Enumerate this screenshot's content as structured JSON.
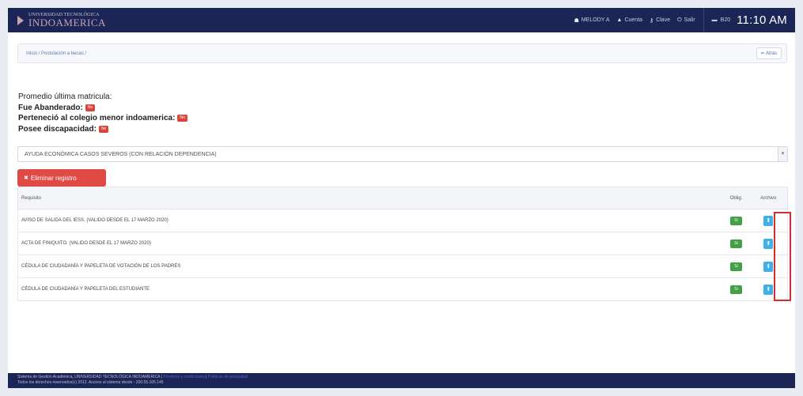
{
  "header": {
    "logo_small": "UNIVERSIDAD TECNOLÓGICA",
    "logo_big": "INDOAMERICA",
    "user": "MELODY A",
    "cuenta": "Cuenta",
    "clave": "Clave",
    "salir": "Salir",
    "room": "B20",
    "time": "11:10 AM",
    "icons": {
      "user": "user-icon",
      "cuenta": "person-icon",
      "clave": "key-icon",
      "salir": "power-icon",
      "room": "card-icon"
    }
  },
  "breadcrumb": {
    "text": "Inicio / Postulación a becas /",
    "back_label": "⇐ Atrás"
  },
  "info": {
    "promedio": "Promedio última matricula:",
    "abanderado_label": "Fue Abanderado:",
    "abanderado_value": "No",
    "colegio_label": "Perteneció al colegio menor indoamerica:",
    "colegio_value": "No",
    "discapacidad_label": "Posee discapacidad:",
    "discapacidad_value": "No"
  },
  "select": {
    "value": "AYUDA ECONÓMICA CASOS SEVEROS (CON RELACIÓN DEPENDENCIA)"
  },
  "delete_button": {
    "label": "Eliminar registro"
  },
  "table": {
    "headers": {
      "requisito": "Requisito",
      "oblig": "Oblig.",
      "archivo": "Archivo"
    },
    "rows": [
      {
        "requisito": "AVISO DE SALIDA DEL IESS. (VALIDO DESDE EL 17 MARZO 2020)",
        "oblig": "Si"
      },
      {
        "requisito": "ACTA DE FINIQUITO. (VALIDO DESDE EL 17 MARZO 2020)",
        "oblig": "Si"
      },
      {
        "requisito": "CÉDULA DE CIUDADANÍA Y PAPELETA DE VOTACIÓN DE LOS PADRES",
        "oblig": "Si"
      },
      {
        "requisito": "CÉDULA DE CIUDADANÍA Y PAPELETA DEL ESTUDIANTE",
        "oblig": "Si"
      }
    ]
  },
  "footer": {
    "line1": "Sistema de Gestión Académica, UNIVERSIDAD TECNOLÓGICA INDOAMERICA |",
    "terms": "Términos y condiciones",
    "privacy": "Políticas de privacidad",
    "line2": "Todos los derechos reservados(c) 2012. Acceso al sistema desde - 200.55.165.145"
  },
  "colors": {
    "navy": "#1b2657",
    "danger": "#e04a45",
    "success": "#43a047",
    "info": "#3fb0e8",
    "highlight": "#d32f2f"
  }
}
